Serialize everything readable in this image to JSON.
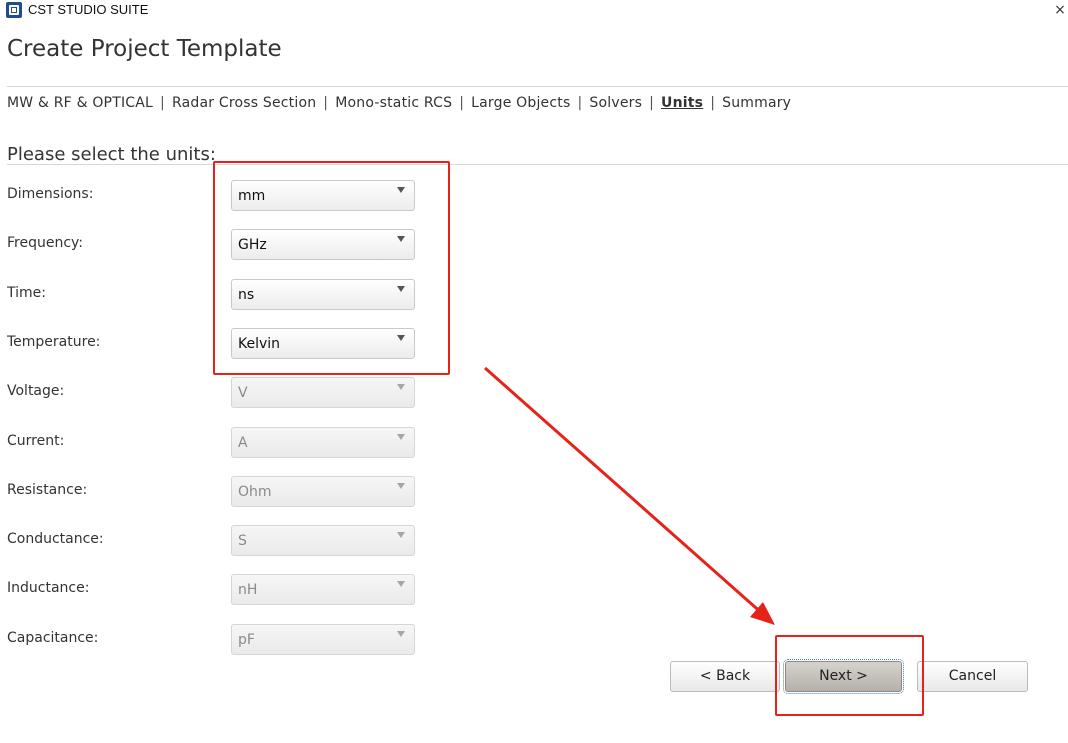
{
  "window": {
    "app_title": "CST STUDIO SUITE",
    "close_glyph": "×"
  },
  "header": {
    "title": "Create Project Template"
  },
  "breadcrumb": [
    {
      "label": "MW & RF & OPTICAL",
      "active": false
    },
    {
      "label": "Radar Cross Section",
      "active": false
    },
    {
      "label": "Mono-static RCS",
      "active": false
    },
    {
      "label": "Large Objects",
      "active": false
    },
    {
      "label": "Solvers",
      "active": false
    },
    {
      "label": "Units",
      "active": true
    },
    {
      "label": "Summary",
      "active": false
    }
  ],
  "breadcrumb_separator": "|",
  "units_section": {
    "heading": "Please select the units:",
    "rows": [
      {
        "label": "Dimensions:",
        "value": "mm",
        "enabled": true
      },
      {
        "label": "Frequency:",
        "value": "GHz",
        "enabled": true
      },
      {
        "label": "Time:",
        "value": "ns",
        "enabled": true
      },
      {
        "label": "Temperature:",
        "value": "Kelvin",
        "enabled": true
      },
      {
        "label": "Voltage:",
        "value": "V",
        "enabled": false
      },
      {
        "label": "Current:",
        "value": "A",
        "enabled": false
      },
      {
        "label": "Resistance:",
        "value": "Ohm",
        "enabled": false
      },
      {
        "label": "Conductance:",
        "value": "S",
        "enabled": false
      },
      {
        "label": "Inductance:",
        "value": "nH",
        "enabled": false
      },
      {
        "label": "Capacitance:",
        "value": "pF",
        "enabled": false
      }
    ]
  },
  "buttons": {
    "back": "< Back",
    "next": "Next >",
    "cancel": "Cancel"
  },
  "colors": {
    "annotation_red": "#e5231b",
    "focus_outline": "#4a78b8"
  }
}
